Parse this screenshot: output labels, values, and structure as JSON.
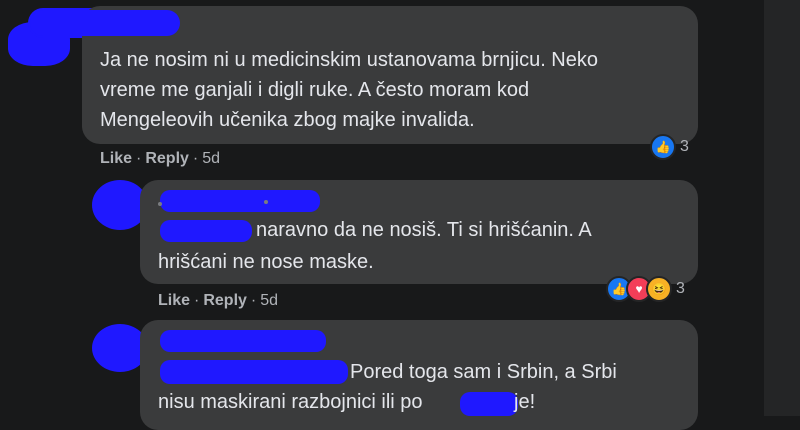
{
  "comments": [
    {
      "text_lines": [
        "Ja ne nosim ni u medicinskim ustanovama brnjicu. Neko",
        "vreme me ganjali i digli ruke. A često moram kod",
        "Mengeleovih učenika zbog majke invalida."
      ],
      "actions": {
        "like": "Like",
        "reply": "Reply",
        "time": "5d"
      },
      "reactions": {
        "icons": [
          "like-icon"
        ],
        "count": "3"
      }
    },
    {
      "text_lines": [
        "naravno da ne nosiš. Ti si hrišćanin. A",
        "hrišćani ne nose maske."
      ],
      "actions": {
        "like": "Like",
        "reply": "Reply",
        "time": "5d"
      },
      "reactions": {
        "icons": [
          "like-icon",
          "love-icon",
          "haha-icon"
        ],
        "count": "3"
      }
    },
    {
      "text_lines": [
        "Pored toga sam i Srbin, a Srbi",
        "nisu maskirani razbojnici ili po",
        "je!"
      ]
    }
  ],
  "colors": {
    "background": "#18191a",
    "bubble": "#3a3b3c",
    "redaction": "#1f18ff",
    "like": "#1877f2"
  }
}
